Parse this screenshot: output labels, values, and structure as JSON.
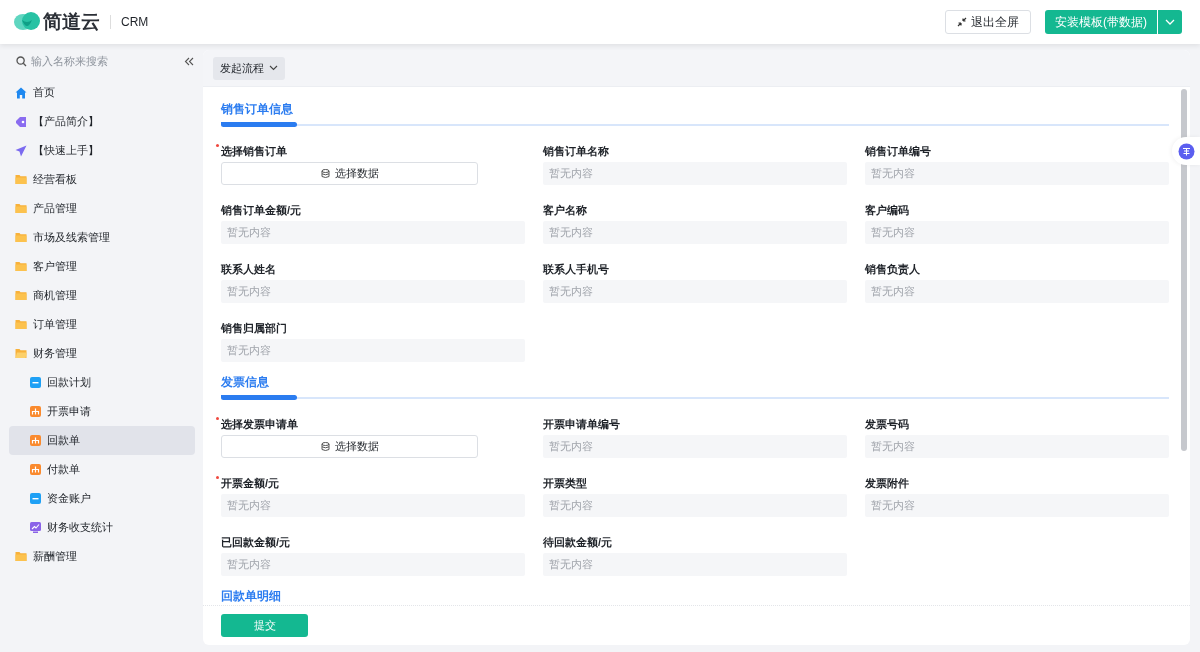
{
  "header": {
    "logo": "简道云",
    "app": "CRM",
    "exit_fullscreen": "退出全屏",
    "install": "安装模板(带数据)"
  },
  "sidebar": {
    "search": {
      "placeholder": "输入名称来搜索"
    },
    "items": [
      {
        "label": "首页",
        "kind": "home",
        "selected": false
      },
      {
        "label": "【产品简介】",
        "kind": "tag",
        "selected": false
      },
      {
        "label": "【快速上手】",
        "kind": "plane",
        "selected": false
      },
      {
        "label": "经营看板",
        "kind": "folder",
        "expanded": false,
        "selected": false
      },
      {
        "label": "产品管理",
        "kind": "folder",
        "expanded": false,
        "selected": false
      },
      {
        "label": "市场及线索管理",
        "kind": "folder",
        "expanded": false,
        "selected": false
      },
      {
        "label": "客户管理",
        "kind": "folder",
        "expanded": false,
        "selected": false
      },
      {
        "label": "商机管理",
        "kind": "folder",
        "expanded": false,
        "selected": false
      },
      {
        "label": "订单管理",
        "kind": "folder",
        "expanded": false,
        "selected": false
      },
      {
        "label": "财务管理",
        "kind": "folder",
        "expanded": true,
        "selected": false,
        "children": [
          {
            "label": "回款计划",
            "kind": "form",
            "selected": false
          },
          {
            "label": "开票申请",
            "kind": "flow",
            "selected": false
          },
          {
            "label": "回款单",
            "kind": "flow",
            "selected": true
          },
          {
            "label": "付款单",
            "kind": "flow",
            "selected": false
          },
          {
            "label": "资金账户",
            "kind": "form",
            "selected": false
          },
          {
            "label": "财务收支统计",
            "kind": "chart",
            "selected": false
          }
        ]
      },
      {
        "label": "薪酬管理",
        "kind": "folder",
        "expanded": false,
        "selected": false
      }
    ]
  },
  "toolbar": {
    "start_flow": "发起流程"
  },
  "sections": [
    {
      "title": "销售订单信息",
      "fields": [
        {
          "label": "选择销售订单",
          "required": true,
          "kind": "picker",
          "button": "选择数据"
        },
        {
          "label": "销售订单名称",
          "required": false,
          "kind": "text",
          "placeholder": "暂无内容"
        },
        {
          "label": "销售订单编号",
          "required": false,
          "kind": "text",
          "placeholder": "暂无内容"
        },
        {
          "label": "销售订单金额/元",
          "required": false,
          "kind": "text",
          "placeholder": "暂无内容"
        },
        {
          "label": "客户名称",
          "required": false,
          "kind": "text",
          "placeholder": "暂无内容"
        },
        {
          "label": "客户编码",
          "required": false,
          "kind": "text",
          "placeholder": "暂无内容"
        },
        {
          "label": "联系人姓名",
          "required": false,
          "kind": "text",
          "placeholder": "暂无内容"
        },
        {
          "label": "联系人手机号",
          "required": false,
          "kind": "text",
          "placeholder": "暂无内容"
        },
        {
          "label": "销售负责人",
          "required": false,
          "kind": "text",
          "placeholder": "暂无内容"
        },
        {
          "label": "销售归属部门",
          "required": false,
          "kind": "text",
          "placeholder": "暂无内容"
        }
      ]
    },
    {
      "title": "发票信息",
      "fields": [
        {
          "label": "选择发票申请单",
          "required": true,
          "kind": "picker",
          "button": "选择数据"
        },
        {
          "label": "开票申请单编号",
          "required": false,
          "kind": "text",
          "placeholder": "暂无内容"
        },
        {
          "label": "发票号码",
          "required": false,
          "kind": "text",
          "placeholder": "暂无内容"
        },
        {
          "label": "开票金额/元",
          "required": true,
          "kind": "text",
          "placeholder": "暂无内容"
        },
        {
          "label": "开票类型",
          "required": false,
          "kind": "text",
          "placeholder": "暂无内容"
        },
        {
          "label": "发票附件",
          "required": false,
          "kind": "text",
          "placeholder": "暂无内容"
        },
        {
          "label": "已回款金额/元",
          "required": false,
          "kind": "text",
          "placeholder": "暂无内容"
        },
        {
          "label": "待回款金额/元",
          "required": false,
          "kind": "text",
          "placeholder": "暂无内容"
        }
      ]
    },
    {
      "title": "回款单明细"
    }
  ],
  "footer": {
    "submit": "提交"
  }
}
